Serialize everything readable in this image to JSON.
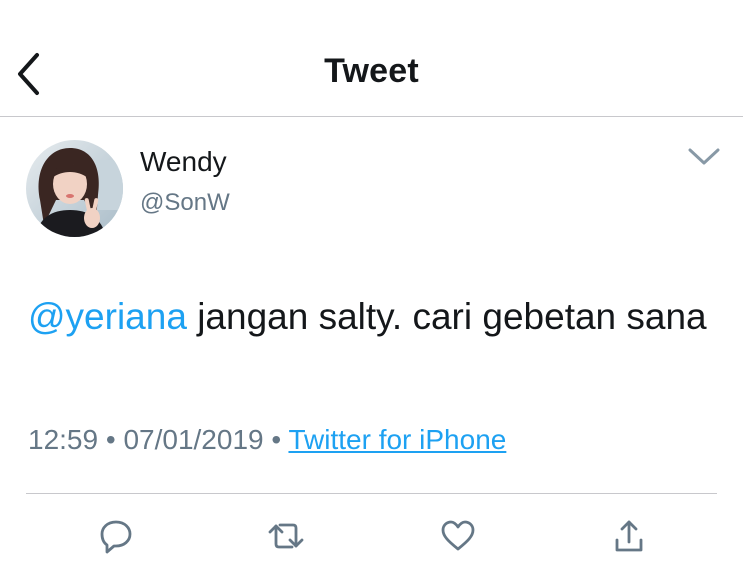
{
  "header": {
    "title": "Tweet",
    "back_icon": "chevron-left-icon"
  },
  "tweet": {
    "author_name": "Wendy",
    "author_handle": "@SonW",
    "mention": "@yeriana",
    "text": " jangan salty. cari gebetan sana",
    "time": "12:59",
    "separator": "•",
    "date": "07/01/2019",
    "source": "Twitter for iPhone"
  },
  "actions": [
    {
      "name": "reply",
      "icon": "reply-icon"
    },
    {
      "name": "retweet",
      "icon": "retweet-icon"
    },
    {
      "name": "like",
      "icon": "heart-icon"
    },
    {
      "name": "share",
      "icon": "share-icon"
    }
  ],
  "colors": {
    "text": "#14171a",
    "secondary": "#657786",
    "accent": "#1da1f2",
    "icon": "#657786",
    "divider": "#c8c8cc"
  }
}
